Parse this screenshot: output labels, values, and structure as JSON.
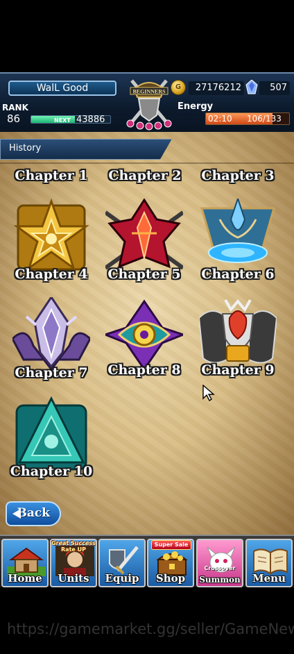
{
  "header": {
    "player_name": "WalL Good",
    "emblem_text": "BEGINNERS",
    "gold": "27176212",
    "gems": "507",
    "rank_label": "RANK",
    "rank": "86",
    "next_label": "NEXT",
    "next_exp": "43886",
    "exp_progress": 0.55,
    "energy_label": "Energy",
    "energy_timer": "02:10",
    "energy_value": "106/133",
    "energy_progress": 0.8
  },
  "history_tab": "History",
  "chapters": [
    {
      "label": "Chapter 1"
    },
    {
      "label": "Chapter 2"
    },
    {
      "label": "Chapter 3"
    },
    {
      "label": "Chapter 4",
      "color": "#e0a51e"
    },
    {
      "label": "Chapter 5",
      "color": "#a3122a"
    },
    {
      "label": "Chapter 6",
      "color": "#2f9ad8"
    },
    {
      "label": "Chapter 7",
      "color": "#8b6fc0"
    },
    {
      "label": "Chapter 8",
      "color": "#8c37c9"
    },
    {
      "label": "Chapter 9",
      "color": "#c83a1f"
    },
    {
      "label": "Chapter 10",
      "color": "#1b8f86"
    }
  ],
  "back_label": "Back",
  "nav": {
    "home": "Home",
    "units": "Units",
    "units_badge_line1": "Great Success",
    "units_badge_line2": "Rate UP",
    "equip": "Equip",
    "shop": "Shop",
    "shop_badge": "Super Sale",
    "summon": "Summon",
    "summon_badge": "Crossover",
    "menu": "Menu"
  },
  "watermark": "https://gamemarket.gg/seller/GameNew"
}
